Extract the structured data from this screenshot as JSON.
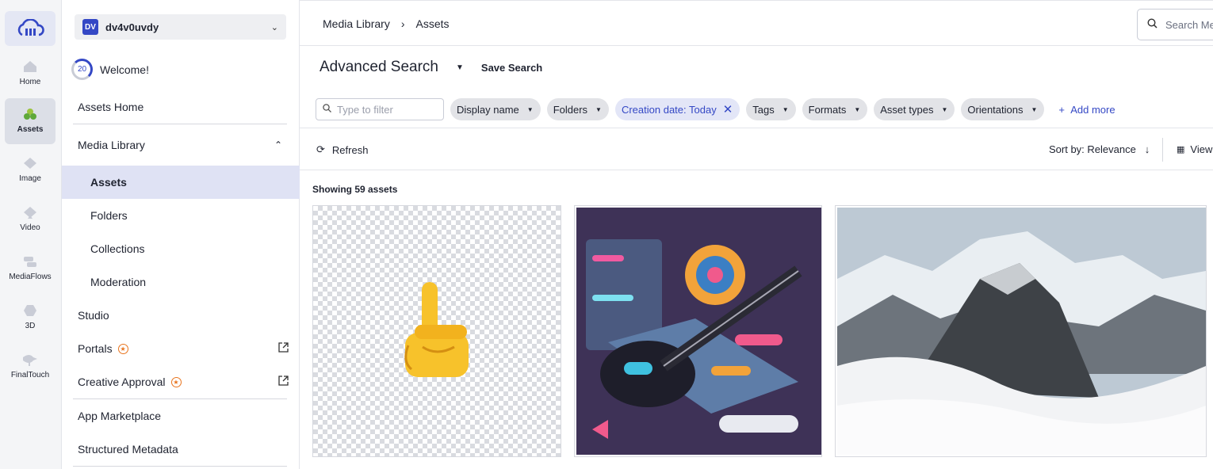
{
  "rail": {
    "items": [
      {
        "label": "Home",
        "icon": "home-icon"
      },
      {
        "label": "Assets",
        "icon": "assets-icon"
      },
      {
        "label": "Image",
        "icon": "image-icon"
      },
      {
        "label": "Video",
        "icon": "video-icon"
      },
      {
        "label": "MediaFlows",
        "icon": "mediaflows-icon"
      },
      {
        "label": "3D",
        "icon": "3d-icon"
      },
      {
        "label": "FinalTouch",
        "icon": "finaltouch-icon"
      }
    ]
  },
  "nav": {
    "cloud_badge": "DV",
    "cloud_name": "dv4v0uvdy",
    "welcome_count": "20",
    "welcome_text": "Welcome!",
    "items": [
      {
        "label": "Assets Home"
      },
      {
        "label": "Media Library"
      },
      {
        "label": "Assets"
      },
      {
        "label": "Folders"
      },
      {
        "label": "Collections"
      },
      {
        "label": "Moderation"
      },
      {
        "label": "Studio"
      },
      {
        "label": "Portals"
      },
      {
        "label": "Creative Approval"
      },
      {
        "label": "App Marketplace"
      },
      {
        "label": "Structured Metadata"
      }
    ]
  },
  "header": {
    "breadcrumb": [
      "Media Library",
      "Assets"
    ],
    "search_placeholder": "Search Me"
  },
  "search": {
    "title": "Advanced Search",
    "save_label": "Save Search",
    "filter_placeholder": "Type to filter",
    "chips": [
      "Display name",
      "Folders",
      "Creation date: Today",
      "Tags",
      "Formats",
      "Asset types",
      "Orientations"
    ],
    "add_more": "Add more"
  },
  "toolbar": {
    "refresh": "Refresh",
    "sort": "Sort by: Relevance",
    "view": "View"
  },
  "results": {
    "showing": "Showing 59 assets"
  },
  "colors": {
    "accent": "#3448c5",
    "premium": "#e8741e"
  }
}
